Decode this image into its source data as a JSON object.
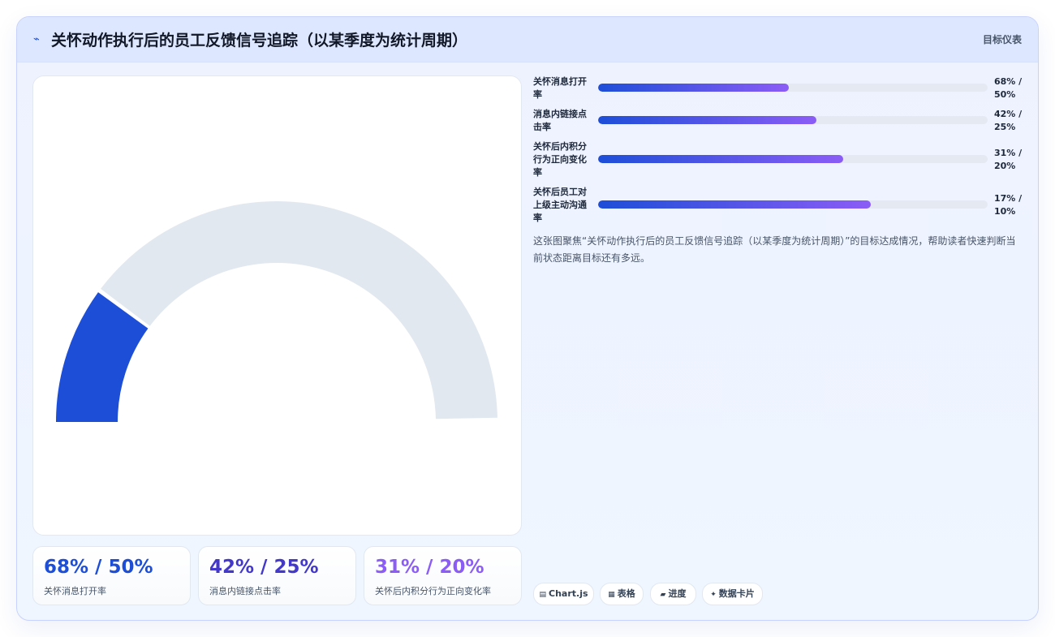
{
  "header": {
    "icon": "pulse-icon",
    "title": "关怀动作执行后的员工反馈信号追踪（以某季度为统计周期）",
    "badge": "目标仪表"
  },
  "chart_data": {
    "type": "gauge",
    "title": "关怀动作执行后的员工反馈信号追踪（以某季度为统计周期）",
    "gauge": {
      "value": 0.2,
      "min": 0,
      "max": 1
    },
    "series": [
      {
        "name": "关怀消息打开率",
        "actual": 68,
        "target": 50,
        "label": "68% / 50%",
        "progress": 0.49
      },
      {
        "name": "消息内链接点击率",
        "actual": 42,
        "target": 25,
        "label": "42% / 25%",
        "progress": 0.56
      },
      {
        "name": "关怀后内积分行为正向变化率",
        "actual": 31,
        "target": 20,
        "label": "31% / 20%",
        "progress": 0.63
      },
      {
        "name": "关怀后员工对上级主动沟通率",
        "actual": 17,
        "target": 10,
        "label": "17% / 10%",
        "progress": 0.7
      }
    ],
    "colors": {
      "primary": "#1d4ed8",
      "accent": "#8b5cf6",
      "track": "#e2e8f0"
    }
  },
  "stats": [
    {
      "value": "68% / 50%",
      "label": "关怀消息打开率",
      "color": "#1d4ed8"
    },
    {
      "value": "42% / 25%",
      "label": "消息内链接点击率",
      "color": "#4338ca"
    },
    {
      "value": "31% / 20%",
      "label": "关怀后内积分行为正向变化率",
      "color": "#8b5cf6"
    }
  ],
  "bars": [
    {
      "label": "关怀消息打开率",
      "value": "68% / 50%"
    },
    {
      "label": "消息内链接点击率",
      "value": "42% / 25%"
    },
    {
      "label": "关怀后内积分行为正向变化率",
      "value": "31% / 20%"
    },
    {
      "label": "关怀后员工对上级主动沟通率",
      "value": "17% / 10%"
    }
  ],
  "description": "这张图聚焦“关怀动作执行后的员工反馈信号追踪（以某季度为统计周期）”的目标达成情况，帮助读者快速判断当前状态距离目标还有多远。",
  "chips": [
    {
      "icon": "chart-icon",
      "glyph": "▤",
      "label": "Chart.js"
    },
    {
      "icon": "table-icon",
      "glyph": "▦",
      "label": "表格"
    },
    {
      "icon": "progress-icon",
      "glyph": "▰",
      "label": "进度"
    },
    {
      "icon": "card-icon",
      "glyph": "✦",
      "label": "数据卡片"
    }
  ]
}
